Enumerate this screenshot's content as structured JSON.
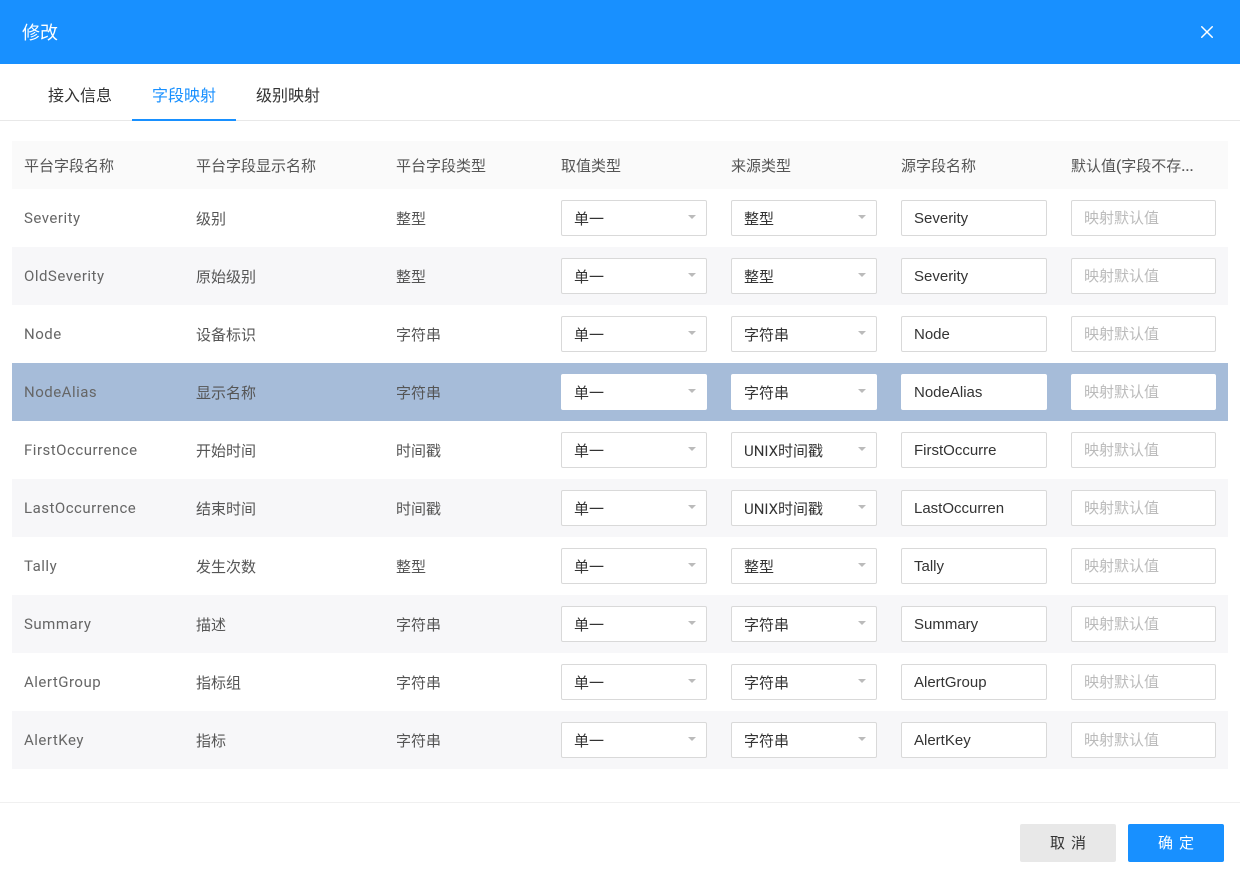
{
  "modal": {
    "title": "修改",
    "close_aria": "close"
  },
  "tabs": [
    {
      "label": "接入信息",
      "active": false
    },
    {
      "label": "字段映射",
      "active": true
    },
    {
      "label": "级别映射",
      "active": false
    }
  ],
  "columns": {
    "field": "平台字段名称",
    "display": "平台字段显示名称",
    "type": "平台字段类型",
    "valtype": "取值类型",
    "srctype": "来源类型",
    "srcfield": "源字段名称",
    "default": "默认值(字段不存..."
  },
  "default_placeholder": "映射默认值",
  "rows": [
    {
      "field": "Severity",
      "display": "级别",
      "type": "整型",
      "valtype": "单一",
      "srctype": "整型",
      "srcfield": "Severity",
      "default": "",
      "selected": false
    },
    {
      "field": "OldSeverity",
      "display": "原始级别",
      "type": "整型",
      "valtype": "单一",
      "srctype": "整型",
      "srcfield": "Severity",
      "default": "",
      "selected": false
    },
    {
      "field": "Node",
      "display": "设备标识",
      "type": "字符串",
      "valtype": "单一",
      "srctype": "字符串",
      "srcfield": "Node",
      "default": "",
      "selected": false
    },
    {
      "field": "NodeAlias",
      "display": "显示名称",
      "type": "字符串",
      "valtype": "单一",
      "srctype": "字符串",
      "srcfield": "NodeAlias",
      "default": "",
      "selected": true
    },
    {
      "field": "FirstOccurrence",
      "display": "开始时间",
      "type": "时间戳",
      "valtype": "单一",
      "srctype": "UNIX时间戳",
      "srcfield": "FirstOccurre",
      "default": "",
      "selected": false
    },
    {
      "field": "LastOccurrence",
      "display": "结束时间",
      "type": "时间戳",
      "valtype": "单一",
      "srctype": "UNIX时间戳",
      "srcfield": "LastOccurren",
      "default": "",
      "selected": false
    },
    {
      "field": "Tally",
      "display": "发生次数",
      "type": "整型",
      "valtype": "单一",
      "srctype": "整型",
      "srcfield": "Tally",
      "default": "",
      "selected": false
    },
    {
      "field": "Summary",
      "display": "描述",
      "type": "字符串",
      "valtype": "单一",
      "srctype": "字符串",
      "srcfield": "Summary",
      "default": "",
      "selected": false
    },
    {
      "field": "AlertGroup",
      "display": "指标组",
      "type": "字符串",
      "valtype": "单一",
      "srctype": "字符串",
      "srcfield": "AlertGroup",
      "default": "",
      "selected": false
    },
    {
      "field": "AlertKey",
      "display": "指标",
      "type": "字符串",
      "valtype": "单一",
      "srctype": "字符串",
      "srcfield": "AlertKey",
      "default": "",
      "selected": false
    }
  ],
  "footer": {
    "cancel": "取消",
    "ok": "确定"
  }
}
